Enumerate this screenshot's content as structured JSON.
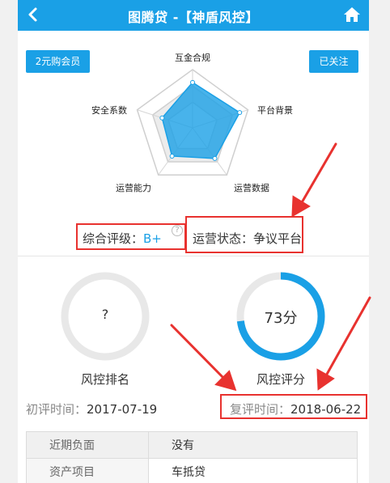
{
  "header": {
    "title": "图腾贷 -【神盾风控】",
    "back_icon": "chevron-left-icon",
    "home_icon": "home-icon",
    "color": "#1aa0e6"
  },
  "buttons": {
    "member": "2元购会员",
    "follow": "已关注"
  },
  "radar": {
    "axes": [
      "互金合规",
      "平台背景",
      "运营数据",
      "运营能力",
      "安全系数"
    ],
    "scores": [
      0.78,
      0.85,
      0.65,
      0.6,
      0.55
    ]
  },
  "rating": {
    "label": "综合评级：",
    "value": "B+",
    "help": "?"
  },
  "status": {
    "label": "运营状态：争议平台"
  },
  "gauges": {
    "left": {
      "value": "?",
      "caption": "风控排名",
      "progress": 0
    },
    "right": {
      "value": "73分",
      "caption": "风控评分",
      "progress": 0.73
    }
  },
  "times": {
    "first_label": "初评时间：",
    "first_value": "2017-07-19",
    "second_label": "复评时间：",
    "second_value": "2018-06-22"
  },
  "table": {
    "rows": [
      {
        "key": "近期负面",
        "value": "没有"
      },
      {
        "key": "资产项目",
        "value": "车抵贷"
      }
    ]
  },
  "colors": {
    "accent": "#1aa0e6",
    "annotation": "#e8322f"
  }
}
